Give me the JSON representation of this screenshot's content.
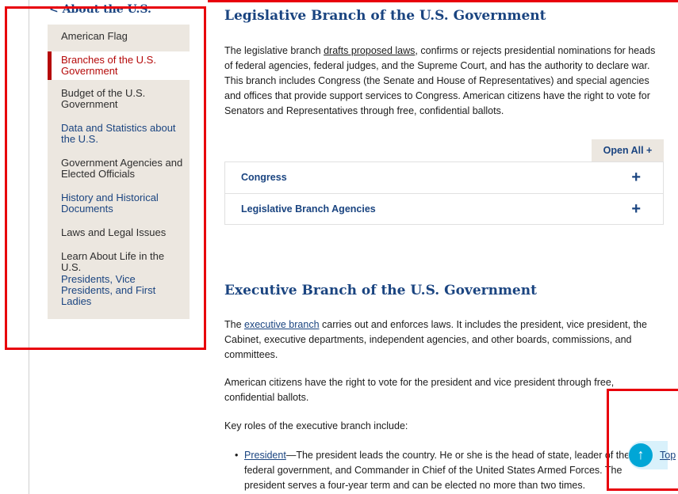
{
  "sidebar": {
    "back_label": "< About the U.S.",
    "items": [
      {
        "label": "American Flag"
      },
      {
        "label": "Branches of the U.S. Government"
      },
      {
        "label": "Budget of the U.S. Government"
      },
      {
        "label": "Data and Statistics about the U.S."
      },
      {
        "label": "Government Agencies and Elected Officials"
      },
      {
        "label": "History and Historical Documents"
      },
      {
        "label": "Laws and Legal Issues"
      },
      {
        "label": "Learn About Life in the U.S."
      },
      {
        "label": "Presidents, Vice Presidents, and First Ladies"
      }
    ]
  },
  "legislative": {
    "title": "Legislative Branch of the U.S. Government",
    "p1_start": "The legislative branch ",
    "p1_link": "drafts proposed laws",
    "p1_rest": ", confirms or rejects presidential nominations for heads of federal agencies, federal judges, and the Supreme Court, and has the authority to declare war. This branch includes Congress (the Senate and House of Representatives) and special agencies and offices that provide support services to Congress. American citizens have the right to vote for Senators and Representatives through free, confidential ballots.",
    "open_all": "Open All +",
    "accordion": [
      {
        "label": "Congress",
        "icon": "+"
      },
      {
        "label": "Legislative Branch Agencies",
        "icon": "+"
      }
    ]
  },
  "executive": {
    "title": "Executive Branch of the U.S. Government",
    "p1_start": "The ",
    "p1_link": "executive branch",
    "p1_rest": " carries out and enforces laws. It includes the president, vice president, the Cabinet, executive departments, independent agencies, and other boards, commissions, and committees.",
    "p2": "American citizens have the right to vote for the president and vice president through free, confidential ballots.",
    "p3": "Key roles of the executive branch include:",
    "bullet1_link": "President",
    "bullet1_rest": "—The president leads the country. He or she is the head of state, leader of the federal government, and Commander in Chief of the United States Armed Forces. The president serves a four-year term and can be elected no more than two times."
  },
  "back_to_top": {
    "arrow": "↑",
    "label": "Top"
  }
}
